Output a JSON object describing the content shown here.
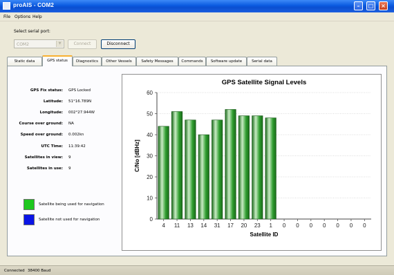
{
  "window": {
    "title": "proAIS - COM2"
  },
  "menu": {
    "items": [
      "File",
      "Options",
      "Help"
    ]
  },
  "connection": {
    "port_label": "Select serial port:",
    "port_value": "COM2",
    "connect_label": "Connect",
    "disconnect_label": "Disconnect"
  },
  "tabs": [
    "Static data",
    "GPS status",
    "Diagnostics",
    "Other Vessels",
    "Safety Messages",
    "Commands",
    "Software update",
    "Serial data"
  ],
  "active_tab": "GPS status",
  "gps": {
    "rows": [
      {
        "label": "GPS Fix status:",
        "value": "GPS Locked"
      },
      {
        "label": "Latitude:",
        "value": "51°16.789N"
      },
      {
        "label": "Longitude:",
        "value": "002°27.944W"
      },
      {
        "label": "Course over ground:",
        "value": "NA"
      },
      {
        "label": "Speed over ground:",
        "value": "0.002kn"
      },
      {
        "label": "UTC Time:",
        "value": "11:39:42"
      },
      {
        "label": "Satellites in view:",
        "value": "9"
      },
      {
        "label": "Satellites in use:",
        "value": "9"
      }
    ]
  },
  "legend": [
    {
      "color": "#1ec81e",
      "text": "Satellite being used for navigation"
    },
    {
      "color": "#0a14e6",
      "text": "Satellite not used for navigation"
    }
  ],
  "colors": {
    "bar_used": "#2e9c2e",
    "bar_light": "#c9ecc4",
    "bar_dark": "#1a6a1a"
  },
  "chart_data": {
    "type": "bar",
    "title": "GPS Satellite Signal Levels",
    "xlabel": "Satellite ID",
    "ylabel": "C/No [dBHz]",
    "ylim": [
      0,
      60
    ],
    "yticks": [
      0,
      10,
      20,
      30,
      40,
      50,
      60
    ],
    "categories": [
      "4",
      "11",
      "13",
      "14",
      "31",
      "17",
      "20",
      "23",
      "1",
      "0",
      "0",
      "0",
      "0",
      "0",
      "0",
      "0"
    ],
    "values": [
      44,
      51,
      47,
      40,
      47,
      52,
      49,
      49,
      48,
      0,
      0,
      0,
      0,
      0,
      0,
      0
    ],
    "grid": true
  },
  "status": {
    "state": "Connected",
    "baud": "38400 Baud"
  }
}
